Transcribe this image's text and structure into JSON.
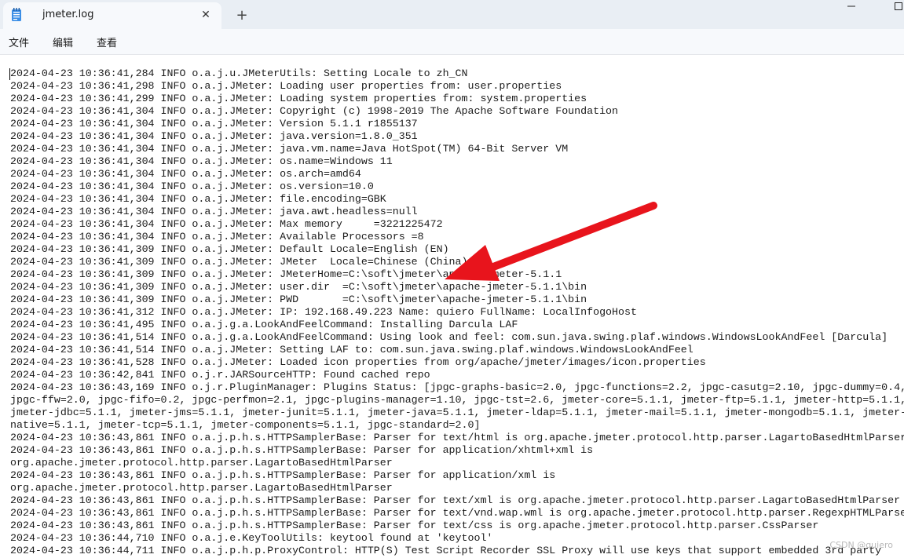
{
  "window": {
    "tab_title": "jmeter.log",
    "close_glyph": "✕",
    "new_tab_glyph": "+"
  },
  "menu": {
    "items": [
      "文件",
      "编辑",
      "查看"
    ]
  },
  "log": {
    "lines": [
      "2024-04-23 10:36:41,284 INFO o.a.j.u.JMeterUtils: Setting Locale to zh_CN",
      "2024-04-23 10:36:41,298 INFO o.a.j.JMeter: Loading user properties from: user.properties",
      "2024-04-23 10:36:41,299 INFO o.a.j.JMeter: Loading system properties from: system.properties",
      "2024-04-23 10:36:41,304 INFO o.a.j.JMeter: Copyright (c) 1998-2019 The Apache Software Foundation",
      "2024-04-23 10:36:41,304 INFO o.a.j.JMeter: Version 5.1.1 r1855137",
      "2024-04-23 10:36:41,304 INFO o.a.j.JMeter: java.version=1.8.0_351",
      "2024-04-23 10:36:41,304 INFO o.a.j.JMeter: java.vm.name=Java HotSpot(TM) 64-Bit Server VM",
      "2024-04-23 10:36:41,304 INFO o.a.j.JMeter: os.name=Windows 11",
      "2024-04-23 10:36:41,304 INFO o.a.j.JMeter: os.arch=amd64",
      "2024-04-23 10:36:41,304 INFO o.a.j.JMeter: os.version=10.0",
      "2024-04-23 10:36:41,304 INFO o.a.j.JMeter: file.encoding=GBK",
      "2024-04-23 10:36:41,304 INFO o.a.j.JMeter: java.awt.headless=null",
      "2024-04-23 10:36:41,304 INFO o.a.j.JMeter: Max memory     =3221225472",
      "2024-04-23 10:36:41,304 INFO o.a.j.JMeter: Available Processors =8",
      "2024-04-23 10:36:41,309 INFO o.a.j.JMeter: Default Locale=English (EN)",
      "2024-04-23 10:36:41,309 INFO o.a.j.JMeter: JMeter  Locale=Chinese (China)",
      "2024-04-23 10:36:41,309 INFO o.a.j.JMeter: JMeterHome=C:\\soft\\jmeter\\apache-jmeter-5.1.1",
      "2024-04-23 10:36:41,309 INFO o.a.j.JMeter: user.dir  =C:\\soft\\jmeter\\apache-jmeter-5.1.1\\bin",
      "2024-04-23 10:36:41,309 INFO o.a.j.JMeter: PWD       =C:\\soft\\jmeter\\apache-jmeter-5.1.1\\bin",
      "2024-04-23 10:36:41,312 INFO o.a.j.JMeter: IP: 192.168.49.223 Name: quiero FullName: LocalInfogoHost",
      "2024-04-23 10:36:41,495 INFO o.a.j.g.a.LookAndFeelCommand: Installing Darcula LAF",
      "2024-04-23 10:36:41,514 INFO o.a.j.g.a.LookAndFeelCommand: Using look and feel: com.sun.java.swing.plaf.windows.WindowsLookAndFeel [Darcula]",
      "2024-04-23 10:36:41,514 INFO o.a.j.JMeter: Setting LAF to: com.sun.java.swing.plaf.windows.WindowsLookAndFeel",
      "2024-04-23 10:36:41,528 INFO o.a.j.JMeter: Loaded icon properties from org/apache/jmeter/images/icon.properties",
      "2024-04-23 10:36:42,841 INFO o.j.r.JARSourceHTTP: Found cached repo",
      "2024-04-23 10:36:43,169 INFO o.j.r.PluginManager: Plugins Status: [jpgc-graphs-basic=2.0, jpgc-functions=2.2, jpgc-casutg=2.10, jpgc-dummy=0.4,",
      "jpgc-ffw=2.0, jpgc-fifo=0.2, jpgc-perfmon=2.1, jpgc-plugins-manager=1.10, jpgc-tst=2.6, jmeter-core=5.1.1, jmeter-ftp=5.1.1, jmeter-http=5.1.1,",
      "jmeter-jdbc=5.1.1, jmeter-jms=5.1.1, jmeter-junit=5.1.1, jmeter-java=5.1.1, jmeter-ldap=5.1.1, jmeter-mail=5.1.1, jmeter-mongodb=5.1.1, jmeter-",
      "native=5.1.1, jmeter-tcp=5.1.1, jmeter-components=5.1.1, jpgc-standard=2.0]",
      "2024-04-23 10:36:43,861 INFO o.a.j.p.h.s.HTTPSamplerBase: Parser for text/html is org.apache.jmeter.protocol.http.parser.LagartoBasedHtmlParser",
      "2024-04-23 10:36:43,861 INFO o.a.j.p.h.s.HTTPSamplerBase: Parser for application/xhtml+xml is",
      "org.apache.jmeter.protocol.http.parser.LagartoBasedHtmlParser",
      "2024-04-23 10:36:43,861 INFO o.a.j.p.h.s.HTTPSamplerBase: Parser for application/xml is",
      "org.apache.jmeter.protocol.http.parser.LagartoBasedHtmlParser",
      "2024-04-23 10:36:43,861 INFO o.a.j.p.h.s.HTTPSamplerBase: Parser for text/xml is org.apache.jmeter.protocol.http.parser.LagartoBasedHtmlParser",
      "2024-04-23 10:36:43,861 INFO o.a.j.p.h.s.HTTPSamplerBase: Parser for text/vnd.wap.wml is org.apache.jmeter.protocol.http.parser.RegexpHTMLParser",
      "2024-04-23 10:36:43,861 INFO o.a.j.p.h.s.HTTPSamplerBase: Parser for text/css is org.apache.jmeter.protocol.http.parser.CssParser",
      "2024-04-23 10:36:44,710 INFO o.a.j.e.KeyToolUtils: keytool found at 'keytool'",
      "2024-04-23 10:36:44,711 INFO o.a.j.p.h.p.ProxyControl: HTTP(S) Test Script Recorder SSL Proxy will use keys that support embedded 3rd party"
    ]
  },
  "watermark": "CSDN @quiero",
  "colors": {
    "annotation_arrow": "#e8141c",
    "titlebar": "#e9eef4",
    "tab": "#f7f9fc"
  }
}
